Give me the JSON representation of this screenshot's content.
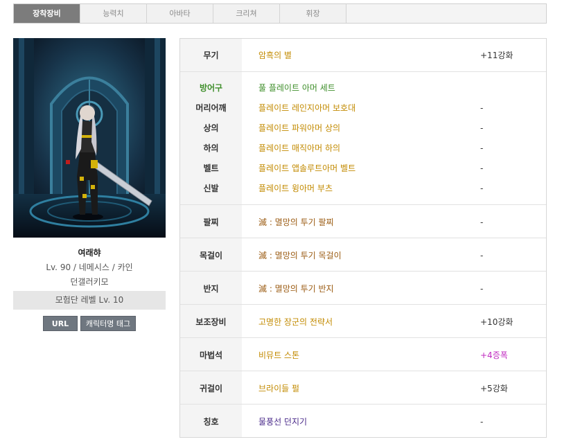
{
  "tabs": [
    "장착장비",
    "능력치",
    "아바타",
    "크리쳐",
    "휘장"
  ],
  "character": {
    "name": "여래햐",
    "class_line": "Lv. 90 / 네메시스 / 카인",
    "server_line": "던갤러키모",
    "adventure_level": "모험단 레벨 Lv. 10",
    "url_button": "URL",
    "tag_button": "캐릭터명 태그"
  },
  "equipment": {
    "weapon": {
      "label": "무기",
      "item": "암흑의 별",
      "value": "+11강화"
    },
    "armor": {
      "label": "방어구",
      "set": "풀 플레이트 아머 세트",
      "pieces": [
        {
          "label": "머리어깨",
          "item": "플레이트 레인지아머 보호대",
          "value": "-"
        },
        {
          "label": "상의",
          "item": "플레이트 파워아머 상의",
          "value": "-"
        },
        {
          "label": "하의",
          "item": "플레이트 매직아머 하의",
          "value": "-"
        },
        {
          "label": "벨트",
          "item": "플레이트 앱솔루트아머 벨트",
          "value": "-"
        },
        {
          "label": "신발",
          "item": "플레이트 윙아머 부츠",
          "value": "-"
        }
      ]
    },
    "bracelet": {
      "label": "팔찌",
      "item": "滅 : 멸망의 투기 팔찌",
      "value": "-"
    },
    "necklace": {
      "label": "목걸이",
      "item": "滅 : 멸망의 투기 목걸이",
      "value": "-"
    },
    "ring": {
      "label": "반지",
      "item": "滅 : 멸망의 투기 반지",
      "value": "-"
    },
    "support": {
      "label": "보조장비",
      "item": "고명한 장군의 전략서",
      "value": "+10강화"
    },
    "magic_stone": {
      "label": "마법석",
      "item": "비뮤트 스톤",
      "value": "+4증폭"
    },
    "earring": {
      "label": "귀걸이",
      "item": "브라이들 펄",
      "value": "+5강화"
    },
    "title": {
      "label": "칭호",
      "item": "물풍선 던지기",
      "value": "-"
    }
  }
}
